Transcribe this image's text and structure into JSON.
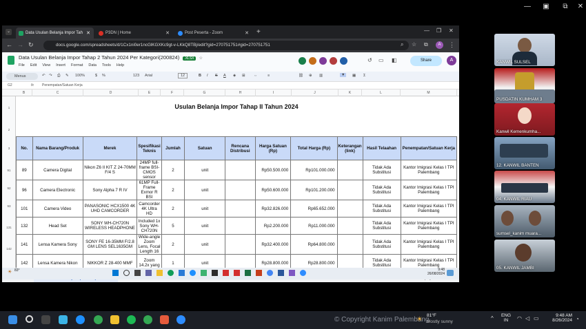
{
  "browser": {
    "tabs": [
      {
        "label": "Data Usulan Belanja Impor Tah",
        "active": true
      },
      {
        "label": "P3DN | Home",
        "active": false
      },
      {
        "label": "Post Peserta - Zoom",
        "active": false
      }
    ],
    "url": "docs.google.com/spreadsheets/d/1Cx1ni0er1ncGlKGXKc9gt-v-LKkQ8TBj/edit?gid=270751751#gid=270751751"
  },
  "sheets": {
    "doc_title": "Data Usulan Belanja Impor Tahap 2 Tahun 2024 Per Kategori(200824)",
    "badge": ".XLSX",
    "menus": [
      "File",
      "Edit",
      "View",
      "Insert",
      "Format",
      "Data",
      "Tools",
      "Help"
    ],
    "share_label": "Share",
    "zoom": "100%",
    "font": "Arial",
    "font_size": "12",
    "cell_ref": "G2",
    "formula": "Penempatan/Satuan Kerja",
    "search": "Menus",
    "columns": [
      "A",
      "B",
      "C",
      "D",
      "E",
      "F",
      "G",
      "H",
      "I",
      "J",
      "K",
      "L",
      "M",
      "N",
      "O"
    ],
    "row_numbers": [
      "1",
      "2",
      "3",
      "91",
      "92",
      "93",
      "131",
      "142",
      "144"
    ],
    "table_title": "Usulan Belanja Impor Tahap II Tahun 2024",
    "headers": [
      "No.",
      "Nama Barang/Produk",
      "Merek",
      "Spesifikasi Teknis",
      "Jumlah",
      "Satuan",
      "Rencana Distribusi",
      "Harga Satuan (Rp)",
      "Total Harga (Rp)",
      "Keterangan (link)",
      "Hasil Telaahan",
      "Penempatan/Satuan Kerja"
    ],
    "rows": [
      [
        "89",
        "Camera Digital",
        "Nikon Z6 II KIT Z 24-70MM F/4 S",
        "24MP full-frame BSI-CMOS sensor",
        "2",
        "unit",
        "",
        "Rp50.500.000",
        "Rp101.000.000",
        "",
        "Tidak Ada Substitusi",
        "Kantor Imigrasi Kelas I TPI Palembang"
      ],
      [
        "96",
        "Camera Electronic",
        "Sony Alpha 7 R IV",
        "61MP Full-Frame Exmor R BSI",
        "2",
        "unit",
        "",
        "Rp50.600.000",
        "Rp101.200.000",
        "",
        "Tidak Ada Substitusi",
        "Kantor Imigrasi Kelas I TPI Palembang"
      ],
      [
        "101",
        "Camera Video",
        "PANASONIC HCX1500 4K UHD CAMCORDER",
        "Camcorder 4K Ultra HD",
        "2",
        "unit",
        "",
        "Rp32.826.000",
        "Rp65.652.000",
        "",
        "Tidak Ada Substitusi",
        "Kantor Imigrasi Kelas I TPI Palembang"
      ],
      [
        "132",
        "Head Set",
        "SONY WH-CH720N WIRELESS HEADPHONE",
        "Included 1x Sony WH-CH720N",
        "5",
        "unit",
        "",
        "Rp2.200.000",
        "Rp11.000.000",
        "",
        "Tidak Ada Substitusi",
        "Kantor Imigrasi Kelas I TPI Palembang"
      ],
      [
        "141",
        "Lensa Kamera Sony",
        "SONY FE 16-35MM F/2.8 GM LENS SEL1635GM",
        "Wide-angle Zoom Lens, Focal Length 16",
        "2",
        "unit",
        "",
        "Rp32.400.000",
        "Rp64.800.000",
        "",
        "Tidak Ada Substitusi",
        "Kantor Imigrasi Kelas I TPI Palembang"
      ],
      [
        "142",
        "Lensa Kamera Nikon",
        "NIKKOR Z 28-400 MMF",
        "Zoom 14.2x yang",
        "1",
        "unit",
        "",
        "Rp28.800.000",
        "Rp28.800.000",
        "",
        "Tidak Ada Substitusi",
        "Kantor Imigrasi Kelas I TPI Palembang"
      ]
    ],
    "sheet_tab": "Data Usulan Belanja Impor Tahap 2 2024",
    "rows_status": "12 of 273 rows displayed"
  },
  "remote_taskbar": {
    "temp": "83°",
    "time": "9:48",
    "date": "26/08/2024"
  },
  "participants": [
    "KANWIL SULSEL",
    "",
    "PUSDATIN KUMHAM 3",
    "Kanwil Kemenkumha...",
    "12. KANWIL BANTEN",
    "04. KANWIL RIAU",
    "sumsel_kanim muara...",
    "05. KANWIL JAMBI"
  ],
  "taskbar": {
    "weather_temp": "81°F",
    "weather_desc": "Mostly sunny",
    "lang1": "ENG",
    "lang2": "IN",
    "time": "9:48 AM",
    "date": "8/26/2024",
    "watermark": "© Copyright Kanim Palembang"
  }
}
